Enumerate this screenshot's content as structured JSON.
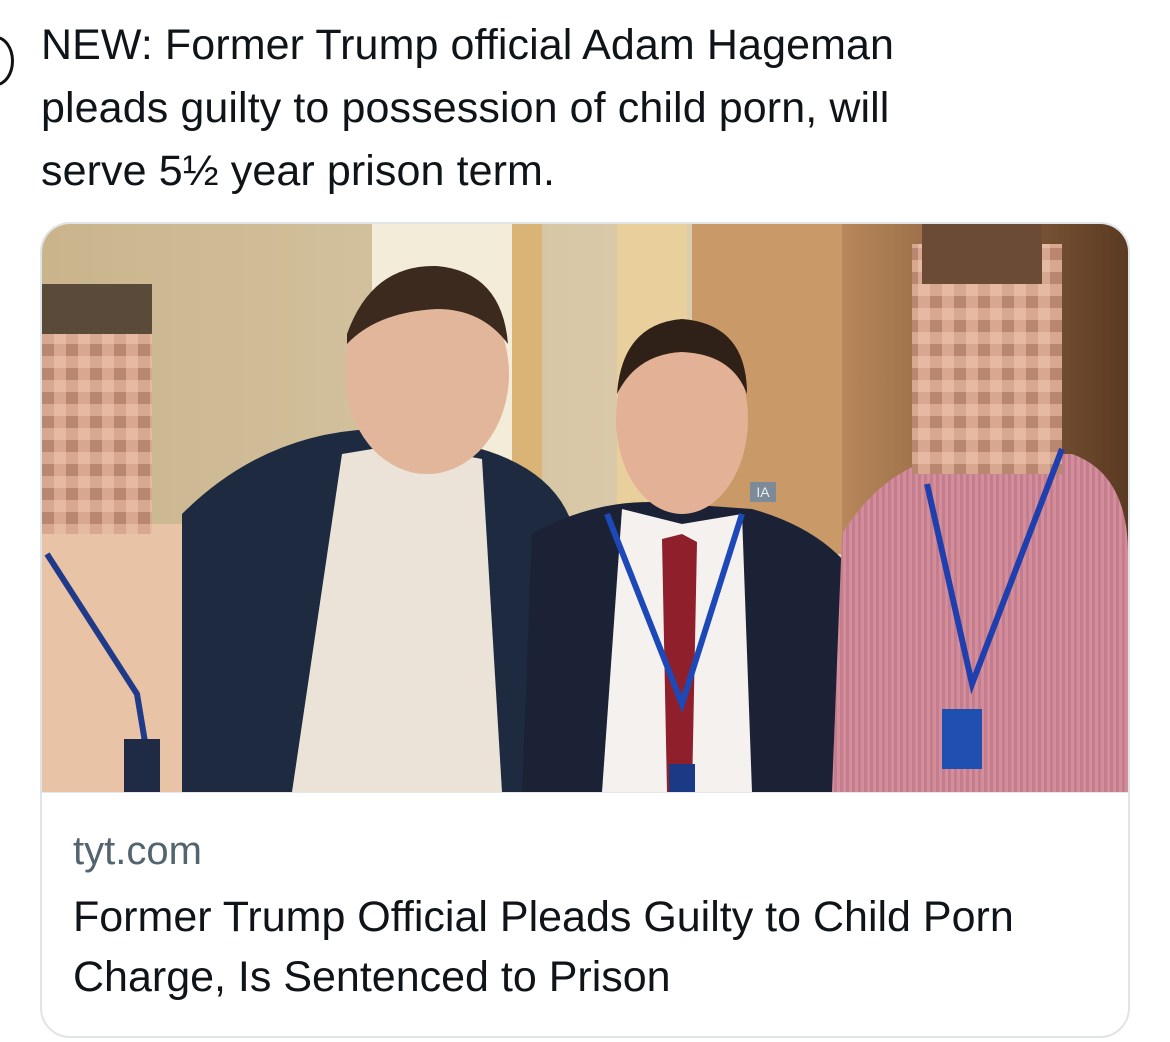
{
  "tweet": {
    "text": "NEW: Former Trump official Adam Hageman\npleads guilty to possession of child porn, will\nserve 5½ year prison term."
  },
  "card": {
    "domain": "tyt.com",
    "title": "Former Trump Official Pleads Guilty to Child Porn Charge, Is Sentenced to Prison",
    "photo_sign_text": "IA"
  },
  "colors": {
    "text": "#0f1419",
    "secondary_text": "#536471",
    "card_border": "#dfe4e8"
  }
}
